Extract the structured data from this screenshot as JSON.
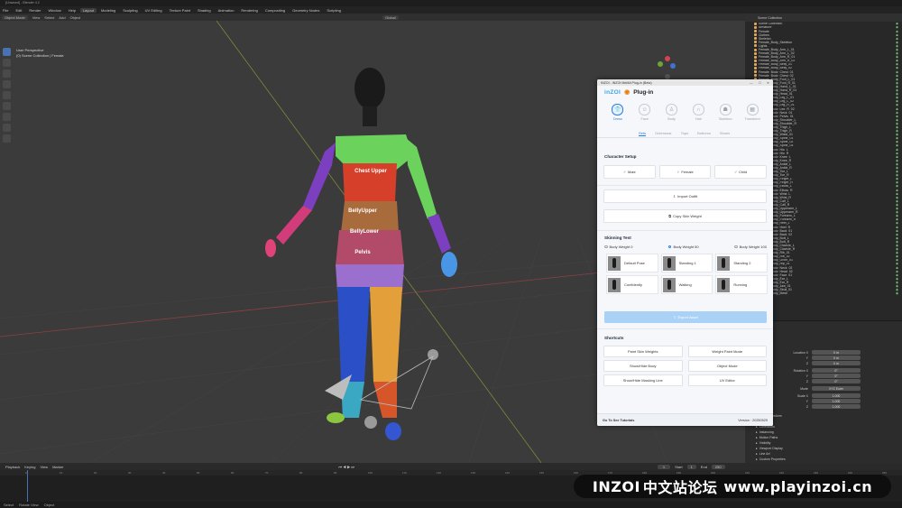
{
  "window": {
    "title": "[Unsaved] - Blender 4.2"
  },
  "menubar": {
    "items": [
      "File",
      "Edit",
      "Render",
      "Window",
      "Help",
      "Layout",
      "Modeling",
      "Sculpting",
      "UV Editing",
      "Texture Paint",
      "Shading",
      "Animation",
      "Rendering",
      "Compositing",
      "Geometry Nodes",
      "Scripting"
    ]
  },
  "viewport_header": {
    "mode": "Object Mode",
    "items": [
      "View",
      "Select",
      "Add",
      "Object"
    ],
    "transform": "Global"
  },
  "viewport": {
    "info_line1": "User Perspective",
    "info_line2": "(0) Scene Collection | Female",
    "body_labels": [
      "Chest Upper",
      "BellyUpper",
      "BellyLower",
      "Pelvis"
    ],
    "colors": {
      "background": "#3b3b3b",
      "grid": "#4a4a4a",
      "x_axis": "#8a4046",
      "y_axis": "#7a8a3c"
    }
  },
  "outliner": {
    "header": "Scene Collection",
    "rows": [
      "Scene Collection",
      "Armature",
      "Female",
      "Clothes",
      "Skeleton",
      "Female_Body_Skeleton",
      "Lights",
      "Female_Body_Arm_L_01",
      "Female_Body_Arm_L_02",
      "Female_Body_Arm_R_01",
      "Female_Body_Arm_R_02",
      "Female_Body_Belly_01",
      "Female_Body_Belly_02",
      "Female_Body_Chest_01",
      "Female_Body_Chest_02",
      "Female_Body_Foot_L_01",
      "Female_Body_Foot_R_01",
      "Female_Body_Hand_L_01",
      "Female_Body_Hand_R_01",
      "Female_Body_Head_01",
      "Female_Body_Leg_L_01",
      "Female_Body_Leg_L_02",
      "Female_Body_Leg_R_01",
      "Female_Body_Leg_R_02",
      "Female_Body_Neck_01",
      "Female_Body_Pelvis_01",
      "Female_Body_Shoulder_L",
      "Female_Body_Shoulder_R",
      "Female_Body_Thigh_L",
      "Female_Body_Thigh_R",
      "Female_Body_Waist_01",
      "Female_Body_Spine_01",
      "Female_Body_Spine_02",
      "Female_Body_Spine_03",
      "Female_Body_Hip_L",
      "Female_Body_Hip_R",
      "Female_Body_Knee_L",
      "Female_Body_Knee_R",
      "Female_Body_Ankle_L",
      "Female_Body_Ankle_R",
      "Female_Body_Toe_L",
      "Female_Body_Toe_R",
      "Female_Body_Finger_L",
      "Female_Body_Finger_R",
      "Female_Body_Elbow_L",
      "Female_Body_Elbow_R",
      "Female_Body_Wrist_L",
      "Female_Body_Wrist_R",
      "Female_Body_Calf_L",
      "Female_Body_Calf_R",
      "Female_Body_Upperarm_L",
      "Female_Body_Upperarm_R",
      "Female_Body_Forearm_L",
      "Female_Body_Forearm_R",
      "Female_Body_Heel_L",
      "Female_Body_Heel_R",
      "Female_Body_Back_01",
      "Female_Body_Back_02",
      "Female_Body_Butt_L",
      "Female_Body_Butt_R",
      "Female_Body_Clavicle_L",
      "Female_Body_Clavicle_R",
      "Female_Body_Rib_01",
      "Female_Body_Rib_02",
      "Female_Body_Groin_01",
      "Female_Body_Hip_01",
      "Female_Body_Neck_02",
      "Female_Body_Head_02",
      "Female_Body_Face_01",
      "Female_Body_Ear_L",
      "Female_Body_Ear_R",
      "Female_Body_Jaw_01",
      "Female_Body_Skull_01",
      "Female_Body_Mesh"
    ]
  },
  "properties": {
    "location_label": "Location X",
    "rotation_label": "Rotation X",
    "mode_label": "Mode",
    "mode_value": "XYZ Euler",
    "scale_label": "Scale X",
    "loc_values": [
      "0 m",
      "0 m",
      "0 m"
    ],
    "rot_values": [
      "0°",
      "0°",
      "0°"
    ],
    "scale_values": [
      "1.000",
      "1.000",
      "1.000"
    ],
    "sections": [
      "Delta Transform",
      "Relations",
      "Collections",
      "Instancing",
      "Motion Paths",
      "Visibility",
      "Viewport Display",
      "Line Art",
      "Custom Properties"
    ]
  },
  "timeline": {
    "playback": "Playback",
    "keying": "Keying",
    "view": "View",
    "marker": "Marker",
    "frame": "1",
    "start_label": "Start",
    "start": "1",
    "end_label": "End",
    "end": "250",
    "ticks": [
      "0",
      "10",
      "20",
      "30",
      "40",
      "50",
      "60",
      "70",
      "80",
      "90",
      "100",
      "110",
      "120",
      "130",
      "140",
      "150",
      "160",
      "170",
      "180",
      "190",
      "200",
      "210",
      "220",
      "230",
      "240",
      "250"
    ]
  },
  "statusbar": {
    "select": "Select",
    "rotate": "Rotate View",
    "menu": "Object"
  },
  "plugin": {
    "window_title": "INZOI - INZOI MeMA Plug-in (Beta)",
    "logo": "inZOI",
    "title": "Plug-in",
    "categories": [
      {
        "label": "Dress",
        "icon": "dress-icon",
        "active": true
      },
      {
        "label": "Face",
        "icon": "face-icon",
        "active": false
      },
      {
        "label": "Body",
        "icon": "body-icon",
        "active": false
      },
      {
        "label": "Hair",
        "icon": "hair-icon",
        "active": false
      },
      {
        "label": "Skeleton",
        "icon": "skeleton-icon",
        "active": false
      },
      {
        "label": "Transform",
        "icon": "transform-icon",
        "active": false
      }
    ],
    "subtabs": [
      "Sets",
      "Outerwear",
      "Tops",
      "Bottoms",
      "Shoes"
    ],
    "character_setup": {
      "title": "Character Setup",
      "male": "Male",
      "female": "Female",
      "child": "Child",
      "import_outfit": "Import Outfit",
      "copy_skin_weight": "Copy Skin Weight"
    },
    "skinning_test": {
      "title": "Skinning Test",
      "options": [
        "Body Weight 0",
        "Body Weight 50",
        "Body Weight 100"
      ],
      "selected": 1,
      "poses": [
        "Default Pose",
        "Standing 1",
        "Standing 2",
        "Confidently",
        "Walking",
        "Running"
      ]
    },
    "export_asset": "Export Asset",
    "shortcuts": {
      "title": "Shortcuts",
      "buttons": [
        "Paint Skin Weights",
        "Weight Paint Mode",
        "Show/Hide Body",
        "Object Mode",
        "Show/Hide Masking Line",
        "UV Editor"
      ]
    },
    "footer": {
      "tutorials": "Go To See Tutorials",
      "version": "Version : 20250529"
    },
    "colors": {
      "accent": "#2a7de1",
      "export_bg": "#a9d2f6",
      "panel_bg": "#f5f7fa"
    }
  },
  "watermark": {
    "brand": "INZOI",
    "cn": "中文站论坛",
    "url": "www.playinzoi.cn"
  }
}
